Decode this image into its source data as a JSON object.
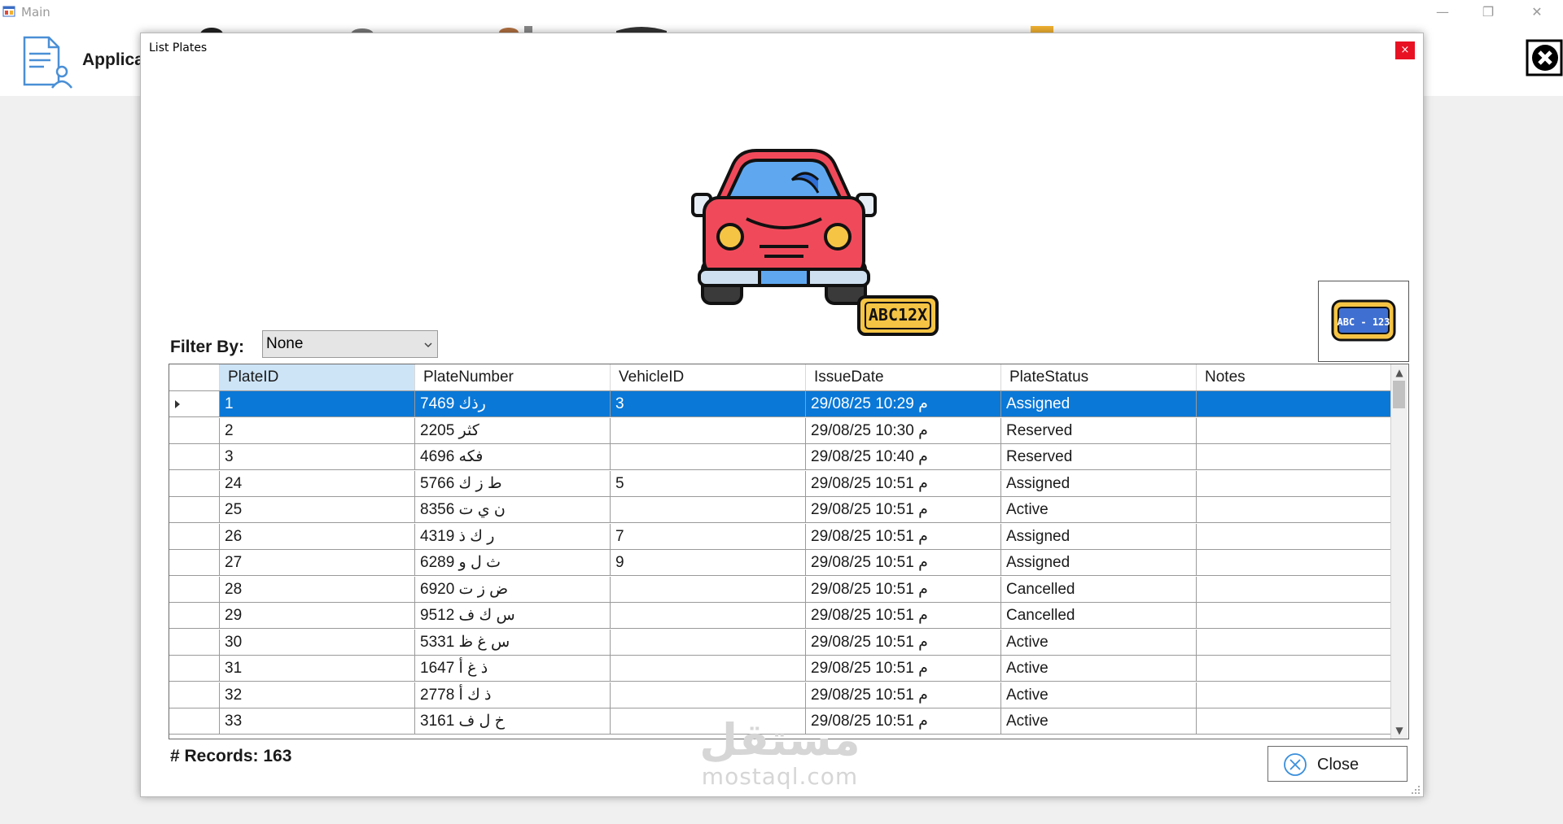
{
  "main_window": {
    "title": "Main",
    "app_label": "Applica",
    "controls": {
      "minimize": "—",
      "maximize": "❐",
      "close": "✕"
    }
  },
  "dialog": {
    "title": "List Plates",
    "close_glyph": "×",
    "hero_plate_text": "ABC12X",
    "add_plate_icon_text": "ABC - 123",
    "filter": {
      "label": "Filter By:",
      "selected": "None"
    },
    "grid": {
      "columns": [
        "PlateID",
        "PlateNumber",
        "VehicleID",
        "IssueDate",
        "PlateStatus",
        "Notes"
      ],
      "rows": [
        {
          "PlateID": "1",
          "PlateNumber": "رذك 7469",
          "VehicleID": "3",
          "IssueDate": "29/08/25 10:29 م",
          "PlateStatus": "Assigned",
          "Notes": ""
        },
        {
          "PlateID": "2",
          "PlateNumber": "كثر 2205",
          "VehicleID": "",
          "IssueDate": "29/08/25 10:30 م",
          "PlateStatus": "Reserved",
          "Notes": ""
        },
        {
          "PlateID": "3",
          "PlateNumber": "فكه 4696",
          "VehicleID": "",
          "IssueDate": "29/08/25 10:40 م",
          "PlateStatus": "Reserved",
          "Notes": ""
        },
        {
          "PlateID": "24",
          "PlateNumber": "ط ز ك 5766",
          "VehicleID": "5",
          "IssueDate": "29/08/25 10:51 م",
          "PlateStatus": "Assigned",
          "Notes": ""
        },
        {
          "PlateID": "25",
          "PlateNumber": "ن ي ت 8356",
          "VehicleID": "",
          "IssueDate": "29/08/25 10:51 م",
          "PlateStatus": "Active",
          "Notes": ""
        },
        {
          "PlateID": "26",
          "PlateNumber": "ر ك ذ 4319",
          "VehicleID": "7",
          "IssueDate": "29/08/25 10:51 م",
          "PlateStatus": "Assigned",
          "Notes": ""
        },
        {
          "PlateID": "27",
          "PlateNumber": "ث ل و 6289",
          "VehicleID": "9",
          "IssueDate": "29/08/25 10:51 م",
          "PlateStatus": "Assigned",
          "Notes": ""
        },
        {
          "PlateID": "28",
          "PlateNumber": "ض ز ت 6920",
          "VehicleID": "",
          "IssueDate": "29/08/25 10:51 م",
          "PlateStatus": "Cancelled",
          "Notes": ""
        },
        {
          "PlateID": "29",
          "PlateNumber": "س ك ف 9512",
          "VehicleID": "",
          "IssueDate": "29/08/25 10:51 م",
          "PlateStatus": "Cancelled",
          "Notes": ""
        },
        {
          "PlateID": "30",
          "PlateNumber": "س غ ظ 5331",
          "VehicleID": "",
          "IssueDate": "29/08/25 10:51 م",
          "PlateStatus": "Active",
          "Notes": ""
        },
        {
          "PlateID": "31",
          "PlateNumber": "ذ غ أ 1647",
          "VehicleID": "",
          "IssueDate": "29/08/25 10:51 م",
          "PlateStatus": "Active",
          "Notes": ""
        },
        {
          "PlateID": "32",
          "PlateNumber": "ذ ك أ 2778",
          "VehicleID": "",
          "IssueDate": "29/08/25 10:51 م",
          "PlateStatus": "Active",
          "Notes": ""
        },
        {
          "PlateID": "33",
          "PlateNumber": "خ ل ف 3161",
          "VehicleID": "",
          "IssueDate": "29/08/25 10:51 م",
          "PlateStatus": "Active",
          "Notes": ""
        }
      ],
      "selected_row": 0
    },
    "records": "# Records: 163",
    "close_button": "Close"
  },
  "watermark": {
    "arabic": "مستقل",
    "latin": "mostaql.com"
  },
  "colors": {
    "selection": "#0a78d7",
    "header_selected": "#cde4f7",
    "close_red": "#e81123",
    "car_red": "#f04a5a",
    "plate_yellow": "#f6c445"
  }
}
